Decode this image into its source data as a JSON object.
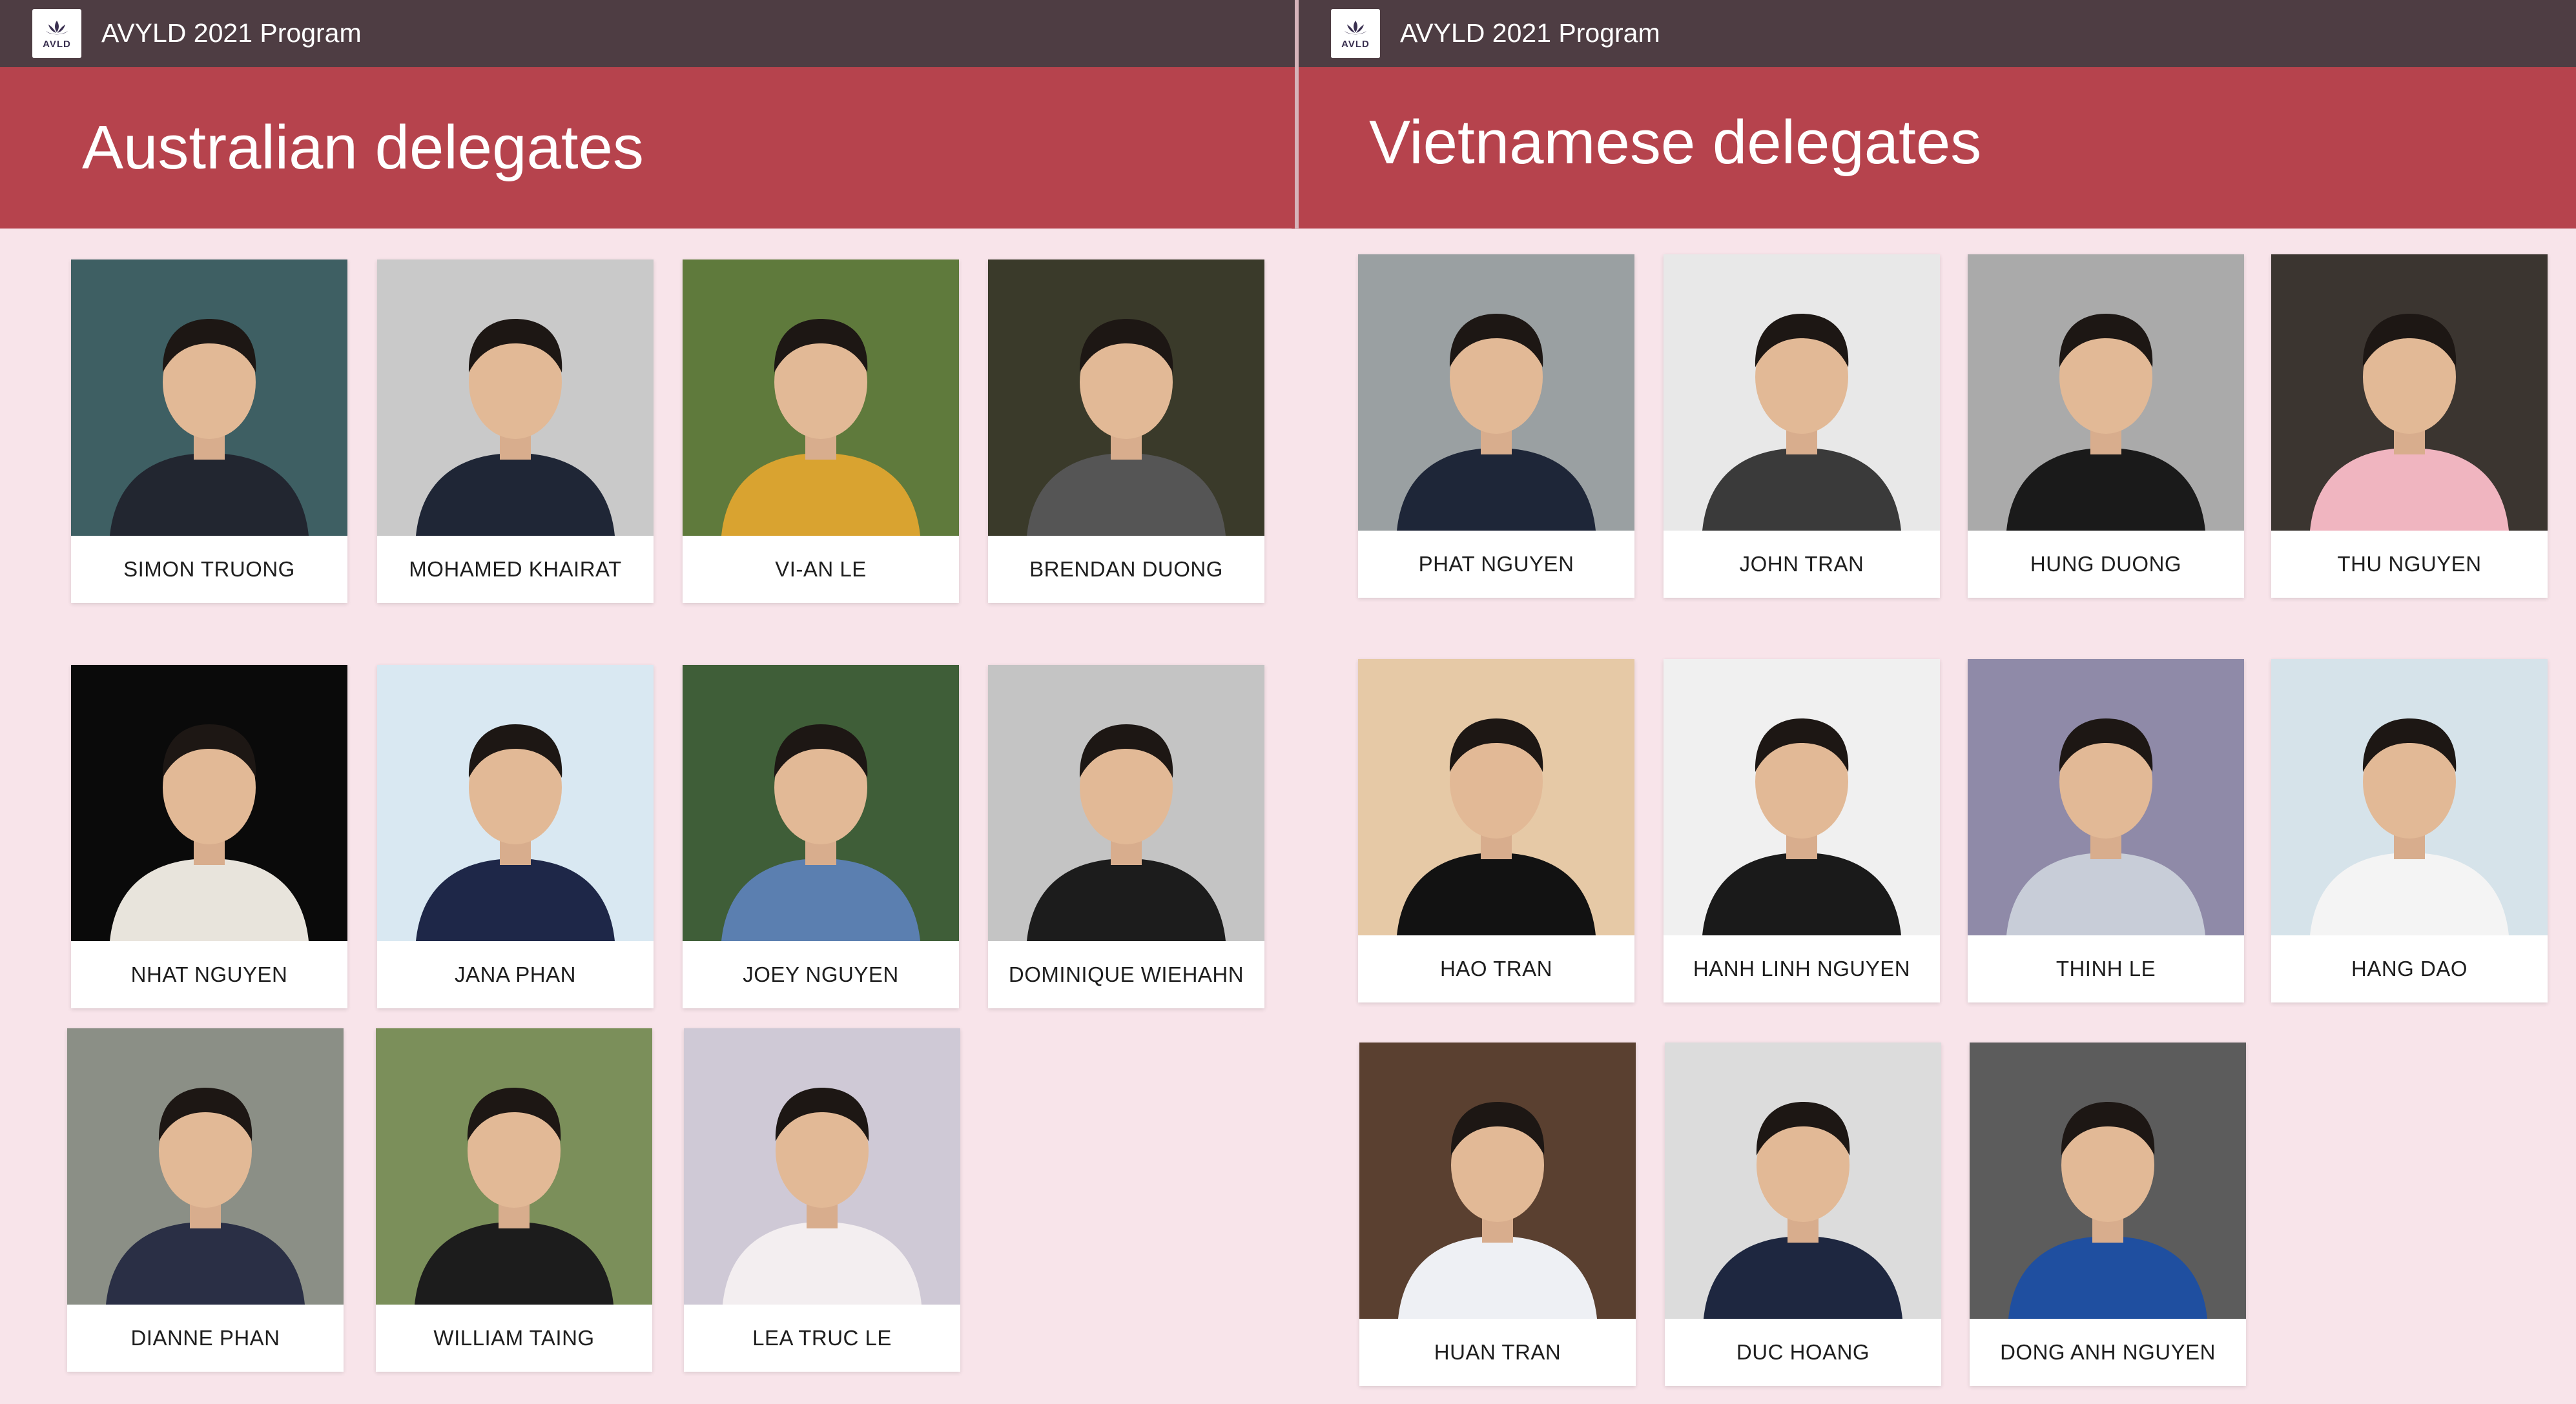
{
  "left_panel": {
    "app_title": "AVYLD 2021 Program",
    "logo_text": "AVLD",
    "heading": "Australian delegates",
    "delegates": [
      {
        "name": "SIMON TRUONG",
        "bg": "#3e5f63",
        "shirt": "#222630"
      },
      {
        "name": "MOHAMED KHAIRAT",
        "bg": "#c9c9c9",
        "shirt": "#1f2636"
      },
      {
        "name": "VI-AN LE",
        "bg": "#5f7a3c",
        "shirt": "#d9a330"
      },
      {
        "name": "BRENDAN DUONG",
        "bg": "#3a3a2a",
        "shirt": "#555555"
      },
      {
        "name": "NHAT NGUYEN",
        "bg": "#0a0a0a",
        "shirt": "#e8e4dc"
      },
      {
        "name": "JANA PHAN",
        "bg": "#d9e8f2",
        "shirt": "#1e2748"
      },
      {
        "name": "JOEY NGUYEN",
        "bg": "#3f5e38",
        "shirt": "#5b7fb0"
      },
      {
        "name": "DOMINIQUE WIEHAHN",
        "bg": "#c4c4c4",
        "shirt": "#1c1c1c"
      },
      {
        "name": "DIANNE PHAN",
        "bg": "#8b8f86",
        "shirt": "#2a2f45"
      },
      {
        "name": "WILLIAM TAING",
        "bg": "#7b8f5a",
        "shirt": "#1c1c1c"
      },
      {
        "name": "LEA TRUC LE",
        "bg": "#cfc9d6",
        "shirt": "#f3eef0"
      }
    ]
  },
  "right_panel": {
    "app_title": "AVYLD 2021 Program",
    "logo_text": "AVLD",
    "heading": "Vietnamese delegates",
    "delegates": [
      {
        "name": "PHAT NGUYEN",
        "bg": "#9aa0a2",
        "shirt": "#1e2638"
      },
      {
        "name": "JOHN TRAN",
        "bg": "#e8e8e8",
        "shirt": "#3a3a3a"
      },
      {
        "name": "HUNG DUONG",
        "bg": "#aaaaaa",
        "shirt": "#1a1a1a"
      },
      {
        "name": "THU NGUYEN",
        "bg": "#3b3530",
        "shirt": "#f0b5c0"
      },
      {
        "name": "HAO TRAN",
        "bg": "#e6c9a6",
        "shirt": "#121212"
      },
      {
        "name": "HANH LINH NGUYEN",
        "bg": "#f0f0f0",
        "shirt": "#1a1a1a"
      },
      {
        "name": "THINH LE",
        "bg": "#8f8aa8",
        "shirt": "#c8cdd8"
      },
      {
        "name": "HANG DAO",
        "bg": "#d6e3ea",
        "shirt": "#f4f4f4"
      },
      {
        "name": "HUAN TRAN",
        "bg": "#5a4030",
        "shirt": "#eef0f4"
      },
      {
        "name": "DUC HOANG",
        "bg": "#dcdcdc",
        "shirt": "#1e2740"
      },
      {
        "name": "DONG ANH NGUYEN",
        "bg": "#5c5c5c",
        "shirt": "#1f4fa0"
      }
    ]
  },
  "colors": {
    "page_bg": "#f8e4ea",
    "topbar": "#4e3d43",
    "banner": "#b6434d"
  }
}
